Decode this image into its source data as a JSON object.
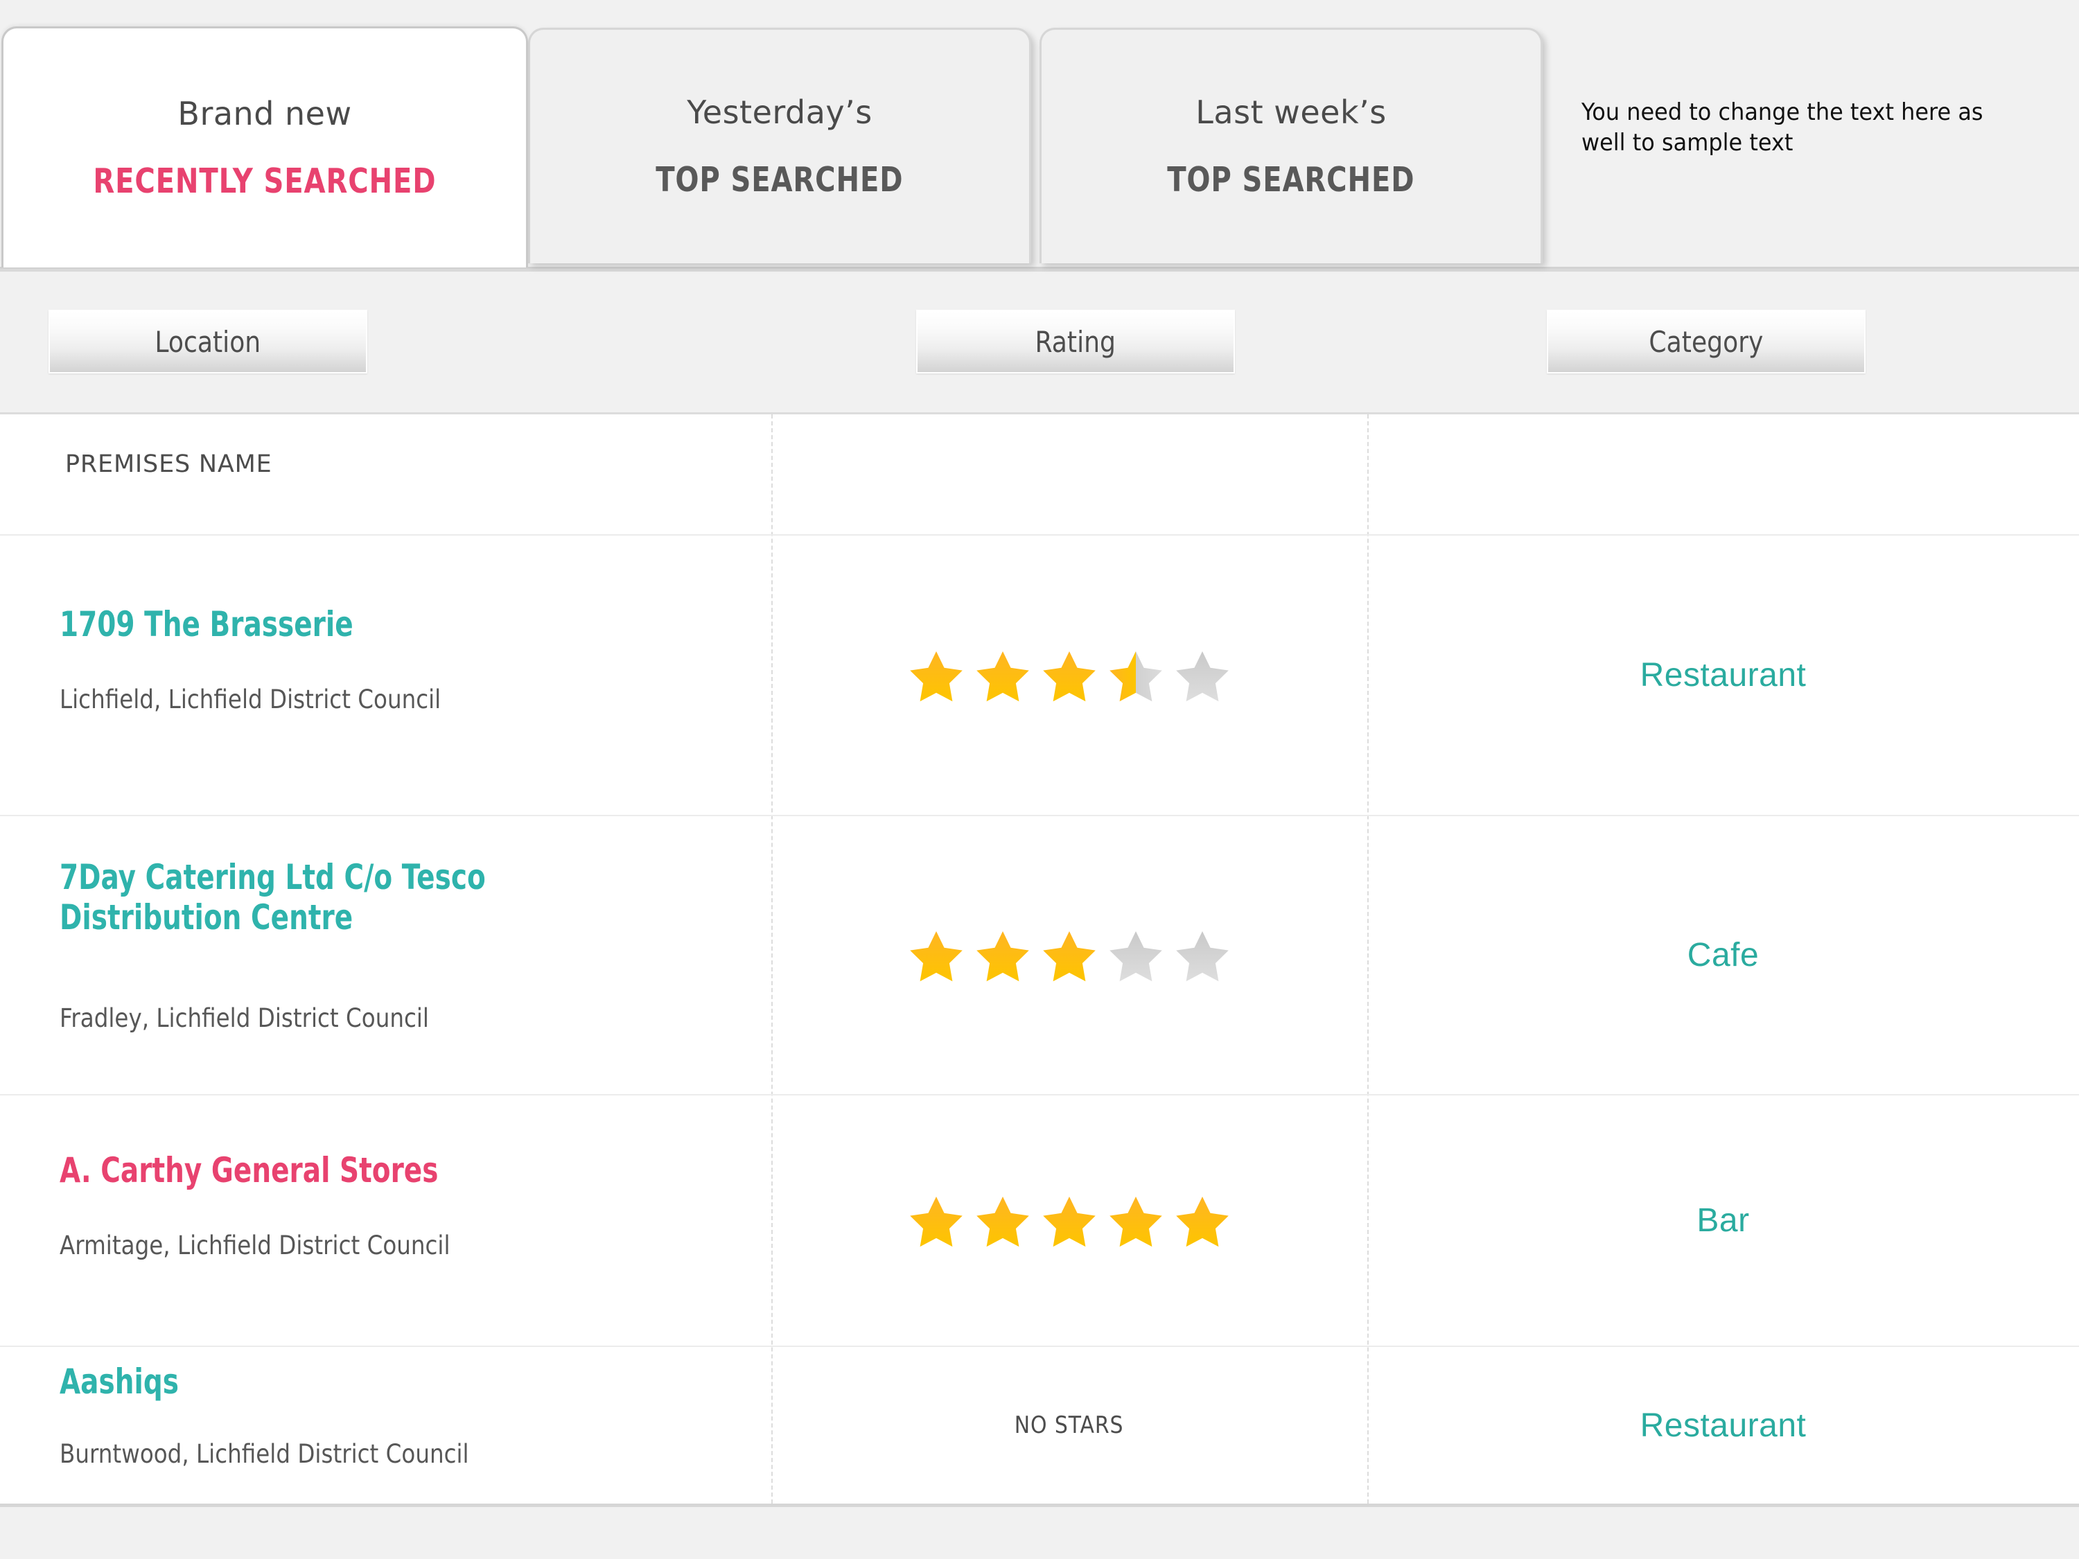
{
  "tabs": [
    {
      "eyebrow": "Brand new",
      "title": "RECENTLY SEARCHED",
      "active": true,
      "accent": "#e8426f"
    },
    {
      "eyebrow": "Yesterday’s",
      "title": "TOP SEARCHED",
      "active": false,
      "accent": "#595959"
    },
    {
      "eyebrow": "Last week’s",
      "title": "TOP SEARCHED",
      "active": false,
      "accent": "#595959"
    }
  ],
  "note": "You need to change the text here as well to sample text",
  "table": {
    "columns": [
      "Location",
      "Rating",
      "Category"
    ],
    "premises_label": "PREMISES NAME",
    "no_stars_label": "NO STARS",
    "rows": [
      {
        "name": "1709 The Brasserie",
        "location": "Lichfield, Lichfield District Council",
        "name_color": "#2fb3ac",
        "rating": 3.5,
        "category": "Restaurant"
      },
      {
        "name": "7Day Catering Ltd C/o Tesco\nDistribution Centre",
        "location": "Fradley, Lichfield District Council",
        "name_color": "#2fb3ac",
        "rating": 3,
        "category": "Cafe"
      },
      {
        "name": "A. Carthy General Stores",
        "location": "Armitage, Lichfield District Council",
        "name_color": "#e8426f",
        "rating": 5,
        "category": "Bar"
      },
      {
        "name": "Aashiqs",
        "location": "Burntwood, Lichfield District Council",
        "name_color": "#2fb3ac",
        "rating": 0,
        "category": "Restaurant"
      }
    ]
  },
  "colors": {
    "teal": "#2fb3ac",
    "pink": "#e8426f",
    "star_filled_top": "#ffb522",
    "star_filled_bottom": "#fdc500",
    "star_empty": "#d4d4d4",
    "page_bg": "#f1f1f1",
    "panel_bg": "#ffffff"
  }
}
